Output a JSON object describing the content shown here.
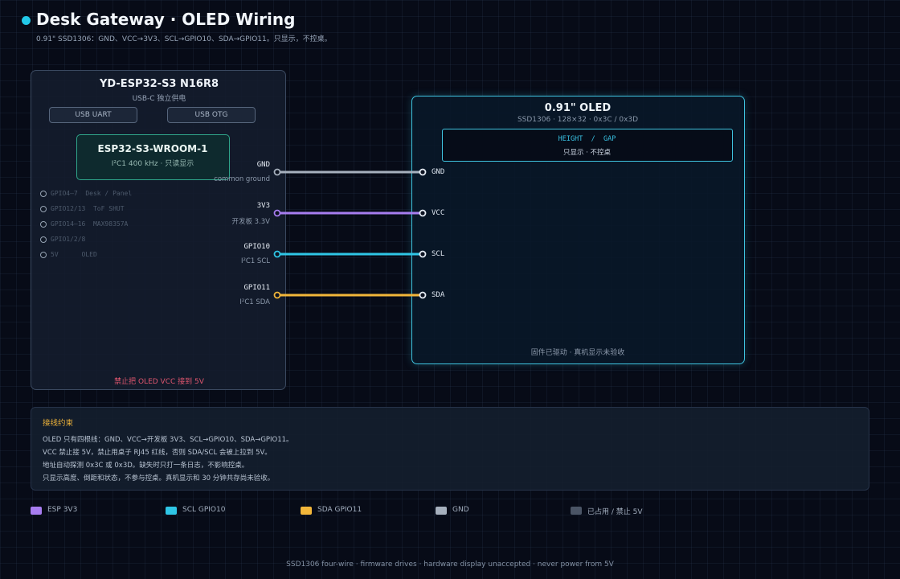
{
  "header": {
    "title": "Desk Gateway · OLED Wiring",
    "subtitle": "0.91\" SSD1306：GND、VCC→3V3、SCL→GPIO10、SDA→GPIO11。只显示，不控桌。"
  },
  "board": {
    "title": "YD-ESP32-S3  N16R8",
    "subtitle": "USB-C 独立供电",
    "usb_uart": "USB UART",
    "usb_otg": "USB OTG",
    "module_title": "ESP32-S3-WROOM-1",
    "module_sub": "I²C1 400 kHz · 只读显示",
    "gpio": [
      "GPIO4–7  Desk / Panel",
      "GPIO12/13  ToF SHUT",
      "GPIO14–16  MAX98357A",
      "GPIO1/2/8",
      "5V      OLED"
    ],
    "warning": "禁止把 OLED VCC 接到 5V"
  },
  "pins": [
    {
      "name": "GND",
      "sub": "common ground",
      "oled": "GND",
      "color": "#a6b0bd"
    },
    {
      "name": "3V3",
      "sub": "开发板 3.3V",
      "oled": "VCC",
      "color": "#a77df0"
    },
    {
      "name": "GPIO10",
      "sub": "I²C1 SCL",
      "oled": "SCL",
      "color": "#2fc6e6"
    },
    {
      "name": "GPIO11",
      "sub": "I²C1 SDA",
      "oled": "SDA",
      "color": "#f2b63a"
    }
  ],
  "oled": {
    "title": "0.91\" OLED",
    "subtitle": "SSD1306 · 128×32 · 0x3C / 0x3D",
    "screen_line1": "HEIGHT  /  GAP",
    "screen_line2": "只显示 · 不控桌",
    "footer": "固件已驱动 · 真机显示未验收"
  },
  "constraints": {
    "title": "接线约束",
    "lines": [
      "OLED 只有四根线：GND、VCC→开发板 3V3、SCL→GPIO10、SDA→GPIO11。",
      "VCC 禁止接 5V，禁止用桌子 RJ45 红线，否则 SDA/SCL 会被上拉到 5V。",
      "地址自动探测 0x3C 或 0x3D。缺失时只打一条日志，不影响控桌。",
      "只显示高度、倒距和状态，不参与控桌。真机显示和 30 分钟共存尚未验收。"
    ]
  },
  "legend": [
    {
      "label": "ESP 3V3",
      "color": "#a77df0"
    },
    {
      "label": "SCL GPIO10",
      "color": "#2fc6e6"
    },
    {
      "label": "SDA GPIO11",
      "color": "#f2b63a"
    },
    {
      "label": "GND",
      "color": "#a6b0bd"
    },
    {
      "label": "已占用 / 禁止 5V",
      "color": "#4b5566"
    }
  ],
  "footer": "SSD1306 four-wire · firmware drives · hardware display unaccepted · never power from 5V"
}
